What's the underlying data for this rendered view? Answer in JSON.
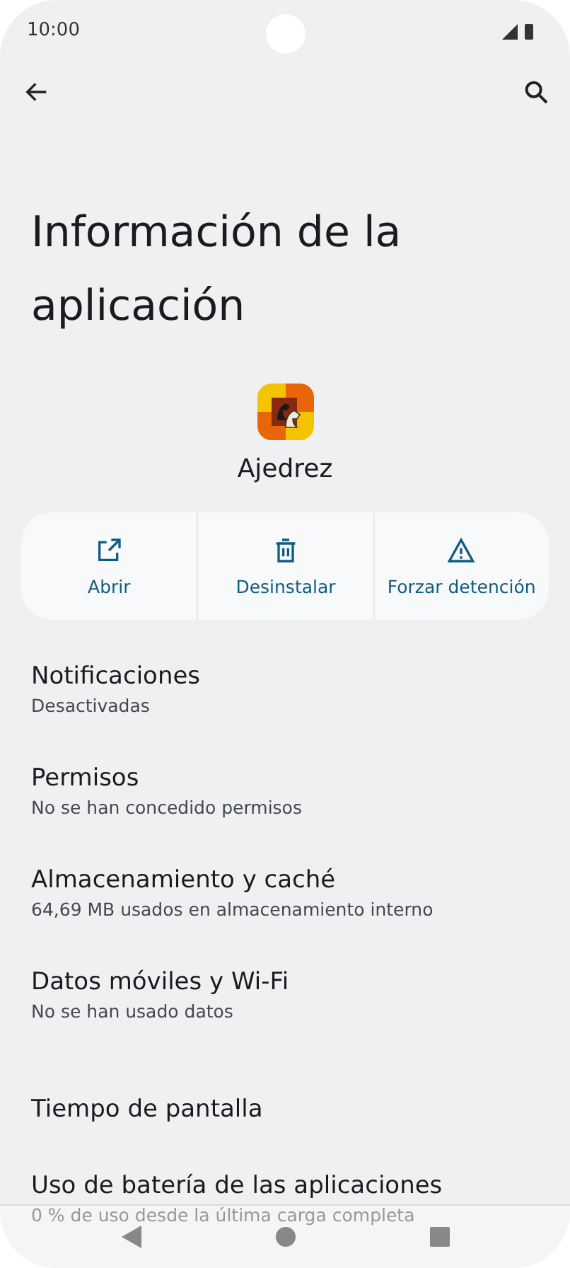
{
  "status_bar": {
    "time": "10:00"
  },
  "title": "Información de la aplicación",
  "app": {
    "name": "Ajedrez"
  },
  "actions": [
    {
      "kind": "open",
      "label": "Abrir"
    },
    {
      "kind": "uninstall",
      "label": "Desinstalar"
    },
    {
      "kind": "force_stop",
      "label": "Forzar detención"
    }
  ],
  "settings": [
    {
      "title": "Notificaciones",
      "subtitle": "Desactivadas"
    },
    {
      "title": "Permisos",
      "subtitle": "No se han concedido permisos"
    },
    {
      "title": "Almacenamiento y caché",
      "subtitle": "64,69 MB usados en almacenamiento interno"
    },
    {
      "title": "Datos móviles y Wi-Fi",
      "subtitle": "No se han usado datos"
    },
    {
      "title": "Tiempo de pantalla"
    },
    {
      "title": "Uso de batería de las aplicaciones",
      "subtitle": "0 % de uso desde la última carga completa"
    }
  ]
}
